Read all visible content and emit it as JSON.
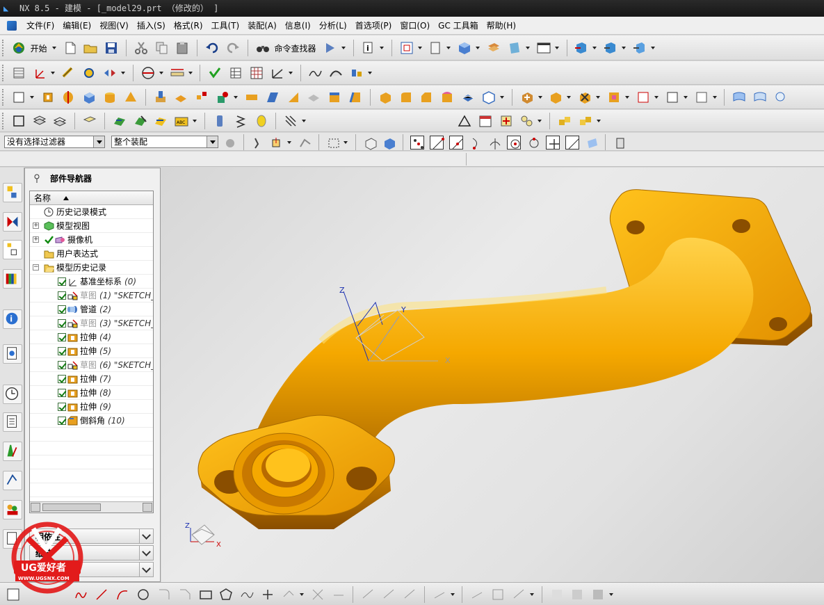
{
  "window": {
    "title": "NX 8.5 - 建模 - [_model29.prt （修改的） ]",
    "logo_icon": "nx-logo-icon"
  },
  "menu": [
    {
      "label": "文件(F)"
    },
    {
      "label": "编辑(E)"
    },
    {
      "label": "视图(V)"
    },
    {
      "label": "插入(S)"
    },
    {
      "label": "格式(R)"
    },
    {
      "label": "工具(T)"
    },
    {
      "label": "装配(A)"
    },
    {
      "label": "信息(I)"
    },
    {
      "label": "分析(L)"
    },
    {
      "label": "首选项(P)"
    },
    {
      "label": "窗口(O)"
    },
    {
      "label": "GC 工具箱"
    },
    {
      "label": "帮助(H)"
    }
  ],
  "toolbar1": {
    "start_label": "开始",
    "command_finder_label": "命令查找器"
  },
  "filter": {
    "selection_filter": "没有选择过滤器",
    "assembly_scope": "整个装配"
  },
  "part_navigator": {
    "title": "部件导航器",
    "column_name": "名称",
    "top_nodes": [
      {
        "label": "历史记录模式",
        "icon": "clock-icon"
      },
      {
        "label": "模型视图",
        "icon": "model-views-icon",
        "expand": "+"
      },
      {
        "label": "摄像机",
        "icon": "camera-icon",
        "expand": "+"
      },
      {
        "label": "用户表达式",
        "icon": "folder-icon"
      },
      {
        "label": "模型历史记录",
        "icon": "folder-open-icon",
        "expand": "−"
      }
    ],
    "features": [
      {
        "label": "基准坐标系",
        "num": "(0)",
        "icon": "datum-csys-icon",
        "dim": false
      },
      {
        "label": "草图",
        "num": "(1) \"SKETCH_",
        "icon": "sketch-icon",
        "dim": true
      },
      {
        "label": "管道",
        "num": "(2)",
        "icon": "tube-icon",
        "dim": false
      },
      {
        "label": "草图",
        "num": "(3) \"SKETCH_",
        "icon": "sketch-icon",
        "dim": true
      },
      {
        "label": "拉伸",
        "num": "(4)",
        "icon": "extrude-icon",
        "dim": false
      },
      {
        "label": "拉伸",
        "num": "(5)",
        "icon": "extrude-icon",
        "dim": false
      },
      {
        "label": "草图",
        "num": "(6) \"SKETCH_",
        "icon": "sketch-icon",
        "dim": true
      },
      {
        "label": "拉伸",
        "num": "(7)",
        "icon": "extrude-icon",
        "dim": false
      },
      {
        "label": "拉伸",
        "num": "(8)",
        "icon": "extrude-icon",
        "dim": false
      },
      {
        "label": "拉伸",
        "num": "(9)",
        "icon": "extrude-icon",
        "dim": false
      },
      {
        "label": "倒斜角",
        "num": "(10)",
        "icon": "chamfer-icon",
        "dim": false
      }
    ],
    "panels": [
      "相依性",
      "细节",
      "预览"
    ]
  },
  "viewport": {
    "wcs_labels": {
      "x": "X",
      "y": "Y",
      "z": "Z"
    },
    "triad_labels": {
      "x": "X",
      "z": "Z"
    },
    "model_color": "#f5a800"
  },
  "watermark": {
    "text": "UG爱好者",
    "url": "WWW.UGSNX.COM"
  }
}
